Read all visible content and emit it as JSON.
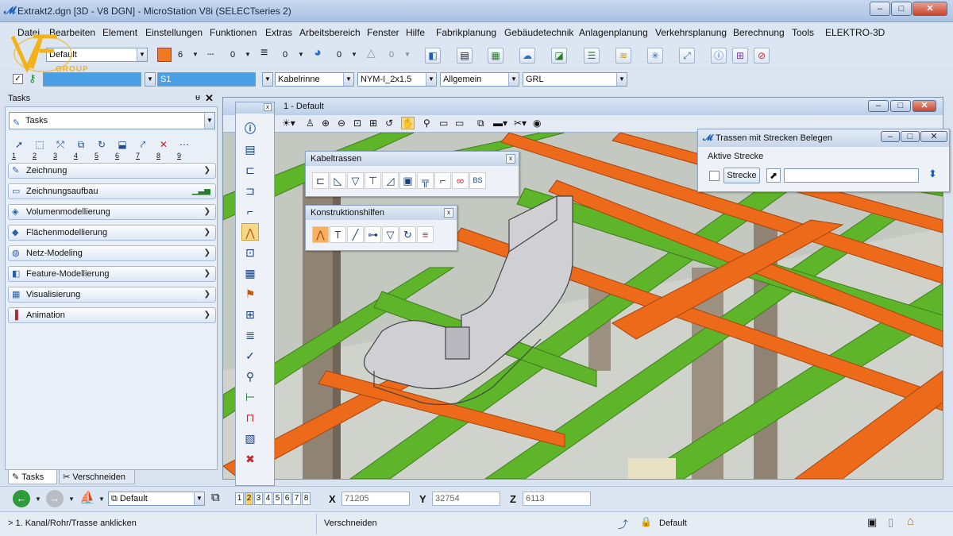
{
  "window": {
    "title": "Extrakt2.dgn [3D - V8 DGN] - MicroStation V8i (SELECTseries 2)",
    "min": "–",
    "max": "□",
    "close": "✕"
  },
  "menu": [
    "Datei",
    "Bearbeiten",
    "Element",
    "Einstellungen",
    "Funktionen",
    "Extras",
    "Arbeitsbereich",
    "Fenster",
    "Hilfe",
    "Fabrikplanung",
    "Gebäudetechnik",
    "Anlagenplanung",
    "Verkehrsplanung",
    "Berechnung",
    "Tools",
    "ELEKTRO-3D"
  ],
  "logo": {
    "text": "GROUP"
  },
  "attrs": {
    "level": "Default",
    "color_num": "6",
    "style_num": "0",
    "weight_num": "0",
    "trans_num": "0",
    "prio_num": "0",
    "accent": "#f07820"
  },
  "row2": {
    "active": "",
    "s1": "S1",
    "type": "Kabelrinne",
    "cable": "NYM-I_2x1.5",
    "general": "Allgemein",
    "grl": "GRL"
  },
  "tasks": {
    "title": "Tasks",
    "pin": "ᵾ",
    "close": "✕",
    "dropdown": "Tasks",
    "toolnums": [
      "1",
      "2",
      "3",
      "4",
      "5",
      "6",
      "7",
      "8",
      "9"
    ],
    "groups": [
      {
        "label": "Zeichnung",
        "icon": "pencil-icon"
      },
      {
        "label": "Zeichnungsaufbau",
        "icon": "monitor-icon"
      },
      {
        "label": "Volumenmodellierung",
        "icon": "solid-icon"
      },
      {
        "label": "Flächenmodellierung",
        "icon": "surface-icon"
      },
      {
        "label": "Netz-Modeling",
        "icon": "mesh-icon"
      },
      {
        "label": "Feature-Modellierung",
        "icon": "feature-icon"
      },
      {
        "label": "Visualisierung",
        "icon": "render-icon"
      },
      {
        "label": "Animation",
        "icon": "film-icon"
      }
    ],
    "tab1": "Tasks",
    "tab2": "Verschneiden"
  },
  "view": {
    "title": "1 - Default",
    "tb_text": "·"
  },
  "kabeltrassen": {
    "title": "Kabeltrassen",
    "close": "x",
    "bs": "BS"
  },
  "konstruktionshilfen": {
    "title": "Konstruktionshilfen",
    "close": "x"
  },
  "trassen": {
    "title": "Trassen mit Strecken Belegen",
    "section": "Aktive Strecke",
    "button": "Strecke",
    "field": ""
  },
  "bottom": {
    "level": "Default",
    "views": [
      "1",
      "2",
      "3",
      "4",
      "5",
      "6",
      "7",
      "8"
    ],
    "x_label": "X",
    "x_value": "71205",
    "y_label": "Y",
    "y_value": "32754",
    "z_label": "Z",
    "z_value": "6113"
  },
  "status": {
    "prompt": "> 1. Kanal/Rohr/Trasse anklicken",
    "tool": "Verschneiden",
    "level": "Default"
  }
}
